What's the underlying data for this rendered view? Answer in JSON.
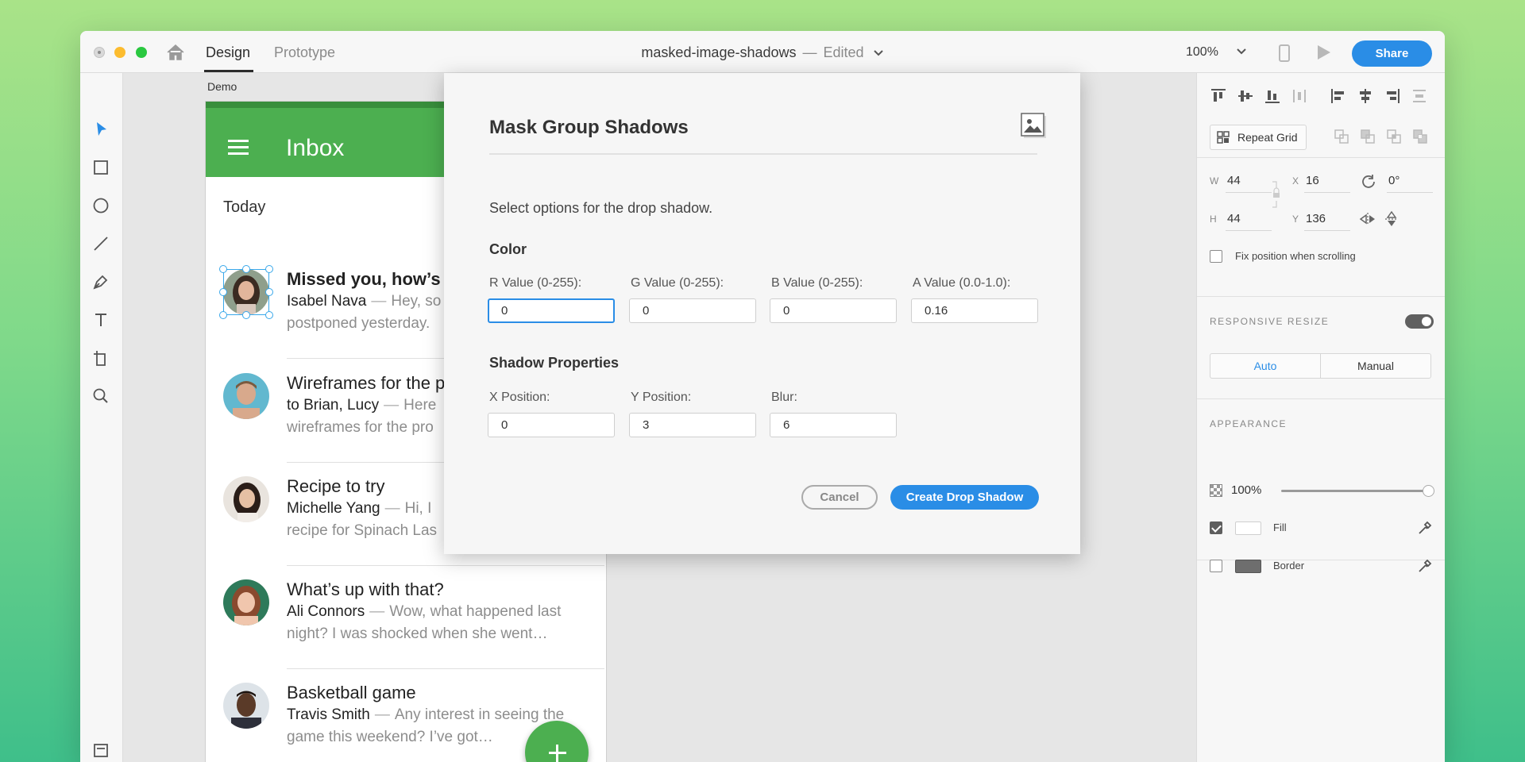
{
  "titlebar": {
    "tabs": [
      {
        "label": "Design",
        "active": true
      },
      {
        "label": "Prototype",
        "active": false
      }
    ],
    "doc_name": "masked-image-shadows",
    "separator": "—",
    "status": "Edited",
    "zoom": "100%",
    "share_label": "Share"
  },
  "canvas": {
    "artboard_label": "Demo",
    "app": {
      "title": "Inbox",
      "section": "Today",
      "messages": [
        {
          "subject": "Missed you, how’s F",
          "from": "Isabel Nava",
          "snippet": "Hey, so",
          "line2": "postponed yesterday.",
          "unread": true
        },
        {
          "subject": "Wireframes for the p",
          "from": "to Brian, Lucy",
          "snippet": "Here",
          "line2": "wireframes for the pro",
          "unread": false
        },
        {
          "subject": "Recipe to try",
          "from": "Michelle Yang",
          "snippet": "Hi, I",
          "line2": "recipe for Spinach Las",
          "unread": false
        },
        {
          "subject": "What’s up with that?",
          "from": "Ali Connors",
          "snippet": "Wow, what happened last",
          "line2": "night? I was shocked when she went…",
          "unread": false
        },
        {
          "subject": "Basketball game",
          "from": "Travis Smith",
          "snippet": "Any interest in seeing the",
          "line2": "game this weekend? I’ve got…",
          "unread": false
        }
      ],
      "dash": "—",
      "fab_icon": "plus-icon",
      "colors": {
        "header": "#4caf50",
        "status_bar": "#388e3c"
      }
    }
  },
  "dialog": {
    "title": "Mask Group Shadows",
    "icon": "image-icon",
    "description": "Select options for the drop shadow.",
    "color_heading": "Color",
    "color_fields": [
      {
        "label": "R Value (0-255):",
        "value": "0",
        "focused": true
      },
      {
        "label": "G Value (0-255):",
        "value": "0",
        "focused": false
      },
      {
        "label": "B Value (0-255):",
        "value": "0",
        "focused": false
      },
      {
        "label": "A Value (0.0-1.0):",
        "value": "0.16",
        "focused": false
      }
    ],
    "shadow_heading": "Shadow Properties",
    "shadow_fields": [
      {
        "label": "X Position:",
        "value": "0"
      },
      {
        "label": "Y Position:",
        "value": "3"
      },
      {
        "label": "Blur:",
        "value": "6"
      }
    ],
    "cancel_label": "Cancel",
    "create_label": "Create Drop Shadow",
    "accent": "#2a8de6"
  },
  "inspector": {
    "repeat_grid_label": "Repeat Grid",
    "w_label": "W",
    "w": "44",
    "h_label": "H",
    "h": "44",
    "x_label": "X",
    "x": "16",
    "y_label": "Y",
    "y": "136",
    "rotation": "0°",
    "fix_position_label": "Fix position when scrolling",
    "responsive_resize_title": "RESPONSIVE RESIZE",
    "responsive_on": true,
    "resize_options": [
      "Auto",
      "Manual"
    ],
    "resize_selected": "Auto",
    "appearance_title": "APPEARANCE",
    "opacity": "100%",
    "opacity_fraction": 1.0,
    "fill_label": "Fill",
    "fill_checked": true,
    "fill_color": "#ffffff",
    "border_label": "Border",
    "border_checked": false,
    "border_color": "#6e6e6e"
  }
}
